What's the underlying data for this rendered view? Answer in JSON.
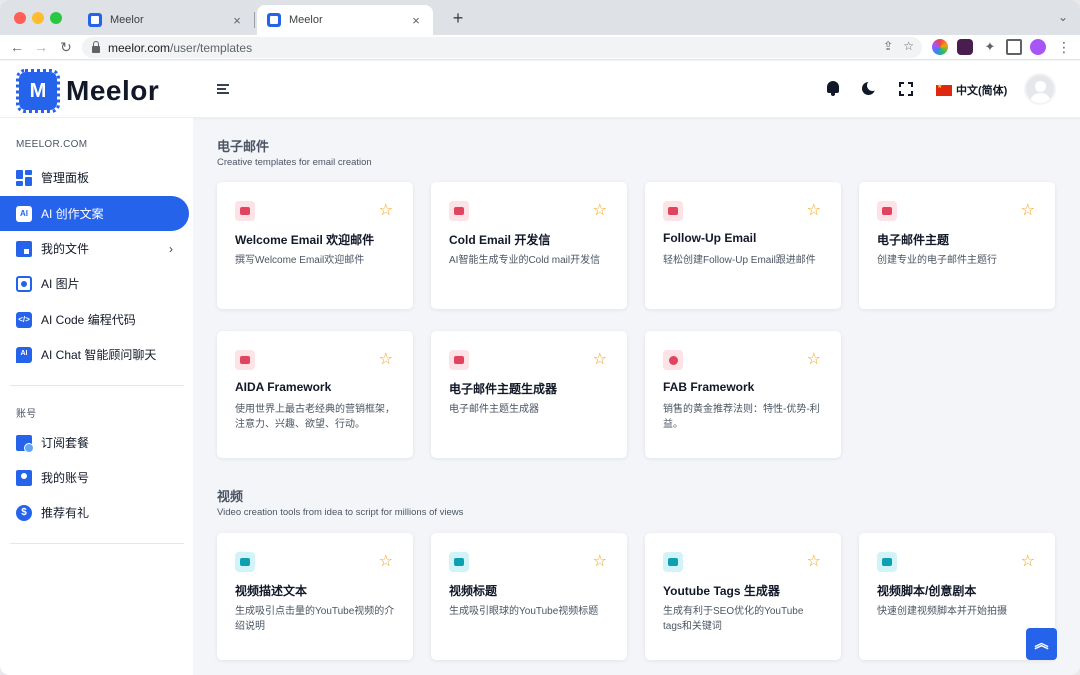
{
  "browser": {
    "tabs": [
      {
        "title": "Meelor",
        "close": "×"
      },
      {
        "title": "Meelor",
        "close": "×"
      }
    ],
    "new_tab": "+",
    "tabs_menu": "⌄",
    "nav": {
      "back": "←",
      "forward": "→",
      "reload": "↻"
    },
    "url": {
      "host": "meelor.com",
      "path": "/user/templates"
    },
    "omni_icons": {
      "share": "⇪",
      "bookmark": "☆"
    },
    "menu": "⋮"
  },
  "header": {
    "logo_mark": "M",
    "logo_text": "Meelor",
    "language": "中文(简体)"
  },
  "sidebar": {
    "section1": "MEELOR.COM",
    "items": [
      {
        "label": "管理面板",
        "icon": "dashboard-icon"
      },
      {
        "label": "AI 创作文案",
        "icon": "ai-icon",
        "active": true
      },
      {
        "label": "我的文件",
        "icon": "folder-icon",
        "chevron": "›"
      },
      {
        "label": "AI 图片",
        "icon": "image-icon"
      },
      {
        "label": "AI Code 编程代码",
        "icon": "code-icon"
      },
      {
        "label": "AI Chat 智能顾问聊天",
        "icon": "chat-icon"
      }
    ],
    "section2": "账号",
    "account_items": [
      {
        "label": "订阅套餐",
        "icon": "subscription-icon"
      },
      {
        "label": "我的账号",
        "icon": "user-icon"
      },
      {
        "label": "推荐有礼",
        "icon": "referral-icon"
      }
    ],
    "icon_glyphs": {
      "ai": "AI",
      "code": "</>",
      "chat": "AI",
      "refer": "$"
    }
  },
  "sections": [
    {
      "title": "电子邮件",
      "subtitle": "Creative templates for email creation",
      "cards": [
        {
          "title": "Welcome Email 欢迎邮件",
          "desc": "撰写Welcome Email欢迎邮件"
        },
        {
          "title": "Cold Email 开发信",
          "desc": "AI智能生成专业的Cold mail开发信"
        },
        {
          "title": "Follow-Up Email",
          "desc": "轻松创建Follow-Up Email跟进邮件"
        },
        {
          "title": "电子邮件主题",
          "desc": "创建专业的电子邮件主题行"
        },
        {
          "title": "AIDA Framework",
          "desc": "使用世界上最古老经典的营销框架，注意力、兴趣、欲望、行动。"
        },
        {
          "title": "电子邮件主题生成器",
          "desc": "电子邮件主题生成器"
        },
        {
          "title": "FAB Framework",
          "desc": "销售的黄金推荐法则：特性-优势-利益。"
        }
      ]
    },
    {
      "title": "视频",
      "subtitle": "Video creation tools from idea to script for millions of views",
      "cards": [
        {
          "title": "视频描述文本",
          "desc": "生成吸引点击量的YouTube视频的介绍说明"
        },
        {
          "title": "视频标题",
          "desc": "生成吸引眼球的YouTube视频标题"
        },
        {
          "title": "Youtube Tags 生成器",
          "desc": "生成有利于SEO优化的YouTube tags和关键词"
        },
        {
          "title": "视频脚本/创意剧本",
          "desc": "快速创建视频脚本并开始拍摄"
        }
      ]
    }
  ],
  "star": "☆",
  "back_to_top": "︽",
  "colors": {
    "accent": "#2563eb",
    "email_icon_bg": "#fde2e6",
    "email_icon": "#e0445e",
    "video_icon_bg": "#d2f3f7",
    "video_icon": "#0e9fb3",
    "star": "#f59e0b"
  }
}
